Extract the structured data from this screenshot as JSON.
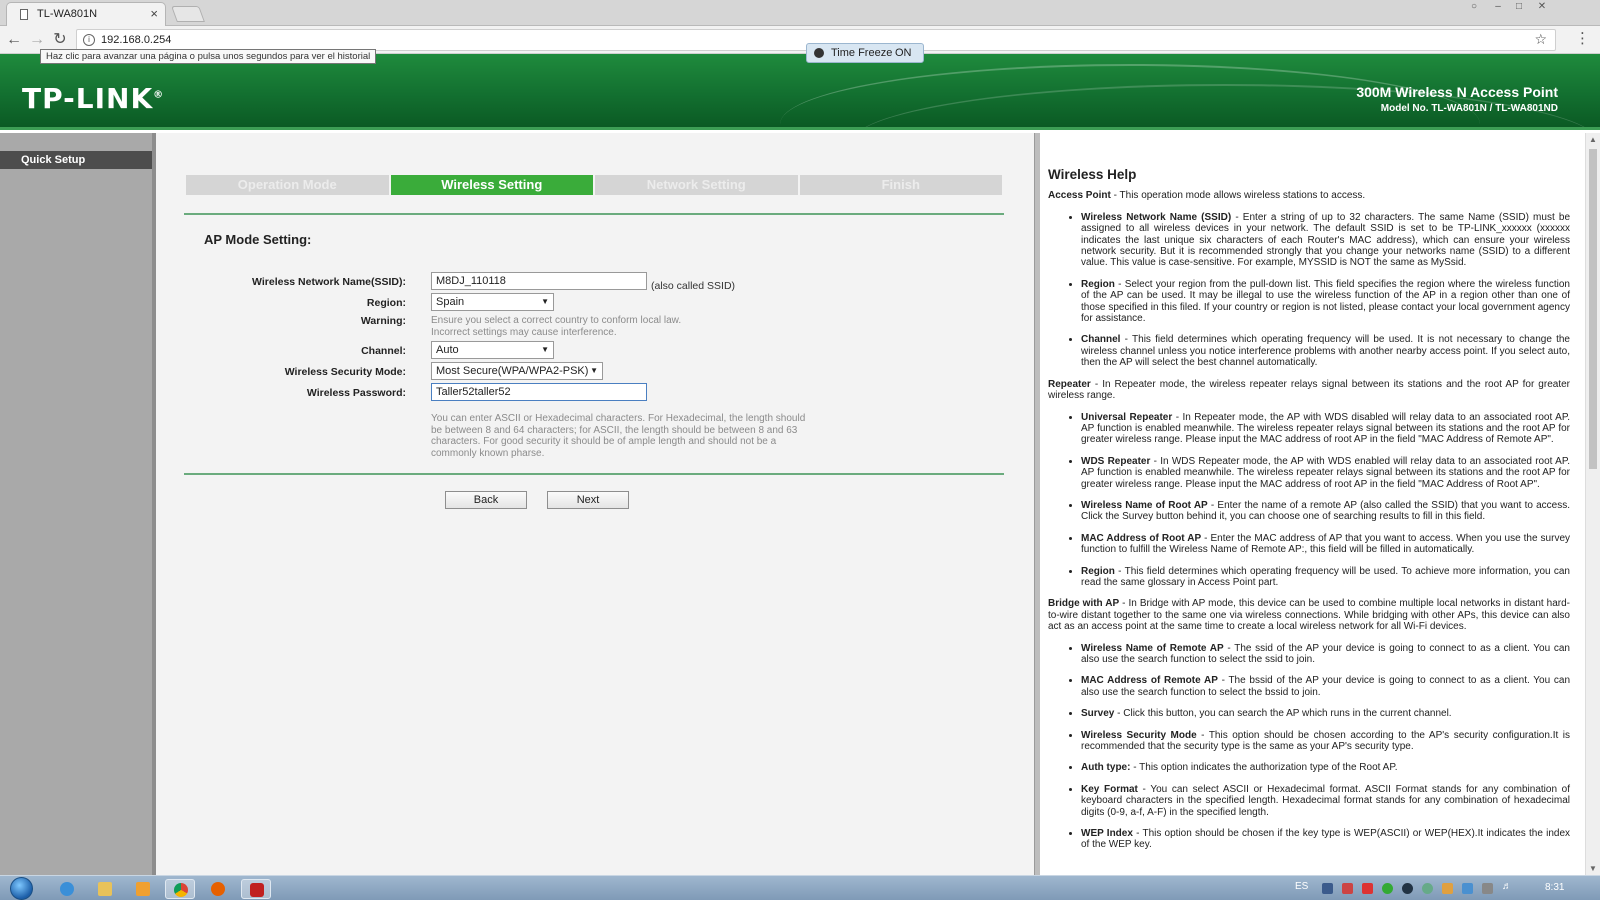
{
  "browser": {
    "tab_title": "TL-WA801N",
    "tab_close": "×",
    "url": "192.168.0.254",
    "tooltip": "Haz clic para avanzar una página o pulsa unos segundos para ver el historial",
    "time_freeze_label": "Time Freeze",
    "time_freeze_state": "ON"
  },
  "header": {
    "logo": "TP-LINK",
    "logo_mark": "®",
    "product": "300M Wireless N Access Point",
    "model": "Model No. TL-WA801N / TL-WA801ND",
    "brand_color": "#137030"
  },
  "sidebar": {
    "items": [
      {
        "label": "Quick Setup"
      }
    ]
  },
  "steps": [
    {
      "label": "Operation Mode",
      "active": false
    },
    {
      "label": "Wireless Setting",
      "active": true
    },
    {
      "label": "Network Setting",
      "active": false
    },
    {
      "label": "Finish",
      "active": false
    }
  ],
  "form": {
    "section_title": "AP Mode Setting:",
    "ssid_label": "Wireless Network Name(SSID):",
    "ssid_value": "M8DJ_110118",
    "ssid_note": "(also called SSID)",
    "region_label": "Region:",
    "region_value": "Spain",
    "warning_label": "Warning:",
    "warning_text_1": "Ensure you select a correct country to conform local law.",
    "warning_text_2": "Incorrect settings may cause interference.",
    "channel_label": "Channel:",
    "channel_value": "Auto",
    "security_label": "Wireless Security Mode:",
    "security_value": "Most Secure(WPA/WPA2-PSK)",
    "password_label": "Wireless Password:",
    "password_value": "Taller52taller52",
    "password_note_1": "You can enter ASCII or Hexadecimal characters. For Hexadecimal, the length should",
    "password_note_2": "be between 8 and 64 characters; for ASCII, the length should be between 8 and 63",
    "password_note_3": "characters. For good security it should be of ample length and should not be a",
    "password_note_4": "commonly known pharse.",
    "back_label": "Back",
    "next_label": "Next"
  },
  "help": {
    "title": "Wireless Help",
    "ap_head": "Access Point",
    "ap_text": " - This operation mode allows wireless stations to access.",
    "ap_items": [
      {
        "term": "Wireless Network Name (SSID)",
        "text": " - Enter a string of up to 32 characters. The same Name (SSID) must be assigned to all wireless devices in your network. The default SSID is set to be TP-LINK_xxxxxx (xxxxxx indicates the last unique six characters of each Router's MAC address), which can ensure your wireless network security. But it is recommended strongly that you change your networks name (SSID) to a different value. This value is case-sensitive. For example, MYSSID is NOT the same as MySsid."
      },
      {
        "term": "Region",
        "text": " - Select your region from the pull-down list. This field specifies the region where the wireless function of the AP can be used. It may be illegal to use the wireless function of the AP in a region other than one of those specified in this filed. If your country or region is not listed, please contact your local government agency for assistance."
      },
      {
        "term": "Channel",
        "text": " - This field determines which operating frequency will be used. It is not necessary to change the wireless channel unless you notice interference problems with another nearby access point. If you select auto, then the AP will select the best channel automatically."
      }
    ],
    "rep_head": "Repeater",
    "rep_text": " - In Repeater mode, the wireless repeater relays signal between its stations and the root AP for greater wireless range.",
    "rep_items": [
      {
        "term": "Universal Repeater",
        "text": " - In Repeater mode, the AP with WDS disabled will relay data to an associated root AP. AP function is enabled meanwhile. The wireless repeater relays signal between its stations and the root AP for greater wireless range. Please input the MAC address of root AP in the field \"MAC Address of Remote AP\"."
      },
      {
        "term": "WDS Repeater",
        "text": " - In WDS Repeater mode, the AP with WDS enabled will relay data to an associated root AP. AP function is enabled meanwhile. The wireless repeater relays signal between its stations and the root AP for greater wireless range. Please input the MAC address of root AP in the field \"MAC Address of Root AP\"."
      },
      {
        "term": "Wireless Name of Root AP",
        "text": " - Enter the name of a remote AP (also called the SSID) that you want to access. Click the Survey button behind it, you can choose one of searching results to fill in this field."
      },
      {
        "term": "MAC Address of Root AP",
        "text": " - Enter the MAC address of AP that you want to access. When you use the survey function to fulfill the Wireless Name of Remote AP:, this field will be filled in automatically."
      },
      {
        "term": "Region",
        "text": " - This field determines which operating frequency will be used. To achieve more information, you can read the same glossary in Access Point part."
      }
    ],
    "bridge_head": "Bridge with AP",
    "bridge_text": " - In Bridge with AP mode, this device can be used to combine multiple local networks in distant hard-to-wire distant together to the same one via wireless connections. While bridging with other APs, this device can also act as an access point at the same time to create a local wireless network for all Wi-Fi devices.",
    "bridge_items": [
      {
        "term": "Wireless Name of Remote AP",
        "text": " - The ssid of the AP your device is going to connect to as a client. You can also use the search function to select the ssid to join."
      },
      {
        "term": "MAC Address of Remote AP",
        "text": " - The bssid of the AP your device is going to connect to as a client. You can also use the search function to select the bssid to join."
      },
      {
        "term": "Survey",
        "text": " - Click this button, you can search the AP which runs in the current channel."
      },
      {
        "term": "Wireless Security Mode",
        "text": " - This option should be chosen according to the AP's security configuration.It is recommended that the security type is the same as your AP's security type."
      },
      {
        "term": "Auth type:",
        "text": " - This option indicates the authorization type of the Root AP."
      },
      {
        "term": "Key Format",
        "text": " - You can select ASCII or Hexadecimal format. ASCII Format stands for any combination of keyboard characters in the specified length. Hexadecimal format stands for any combination of hexadecimal digits (0-9, a-f, A-F) in the specified length."
      },
      {
        "term": "WEP Index",
        "text": " - This option should be chosen if the key type is WEP(ASCII) or WEP(HEX).It indicates the index of the WEP key."
      }
    ]
  },
  "taskbar": {
    "lang": "ES",
    "clock": "8:31"
  }
}
